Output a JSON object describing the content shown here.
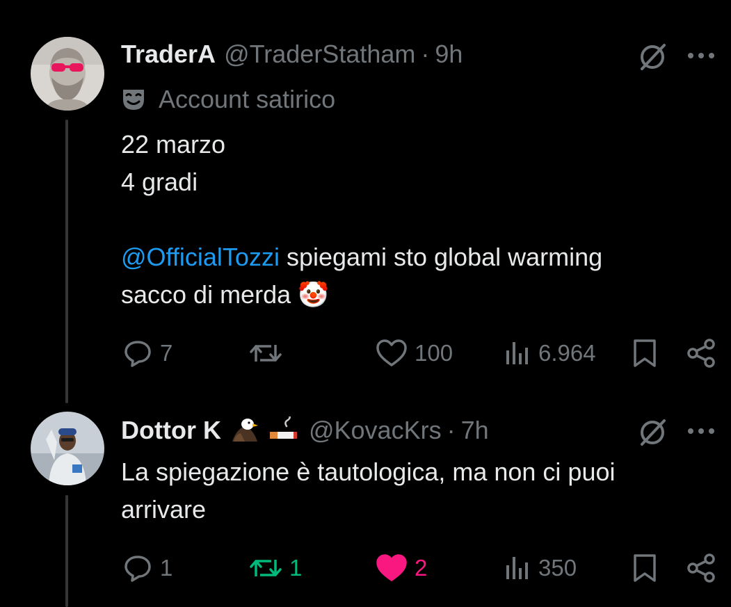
{
  "colors": {
    "background": "#000000",
    "text": "#e7e9ea",
    "secondary": "#71767b",
    "mention": "#1d9bf0",
    "retweet_active": "#00ba7c",
    "like_active": "#f91880",
    "thread_line": "#333639"
  },
  "posts": [
    {
      "display_name": "TraderA",
      "handle": "@TraderStatham",
      "separator": "·",
      "time": "9h",
      "account_label": "Account satirico",
      "account_label_icon": "theater-mask-icon",
      "text_lines": [
        "22 marzo",
        "4 gradi"
      ],
      "mention": "@OfficialTozzi",
      "text_after_mention": " spiegami sto global warming",
      "text_last_line": "sacco di merda",
      "trailing_emoji": "🤡",
      "actions": {
        "replies": "7",
        "retweets": "",
        "likes": "100",
        "views": "6.964"
      },
      "retweeted": false,
      "liked": false
    },
    {
      "display_name": "Dottor K",
      "name_emojis": [
        "🦅",
        "🚬"
      ],
      "handle": "@KovacKrs",
      "separator": "·",
      "time": "7h",
      "text_lines": [
        "La spiegazione è tautologica, ma non ci puoi",
        "arrivare"
      ],
      "actions": {
        "replies": "1",
        "retweets": "1",
        "likes": "2",
        "views": "350"
      },
      "retweeted": true,
      "liked": true
    }
  ]
}
